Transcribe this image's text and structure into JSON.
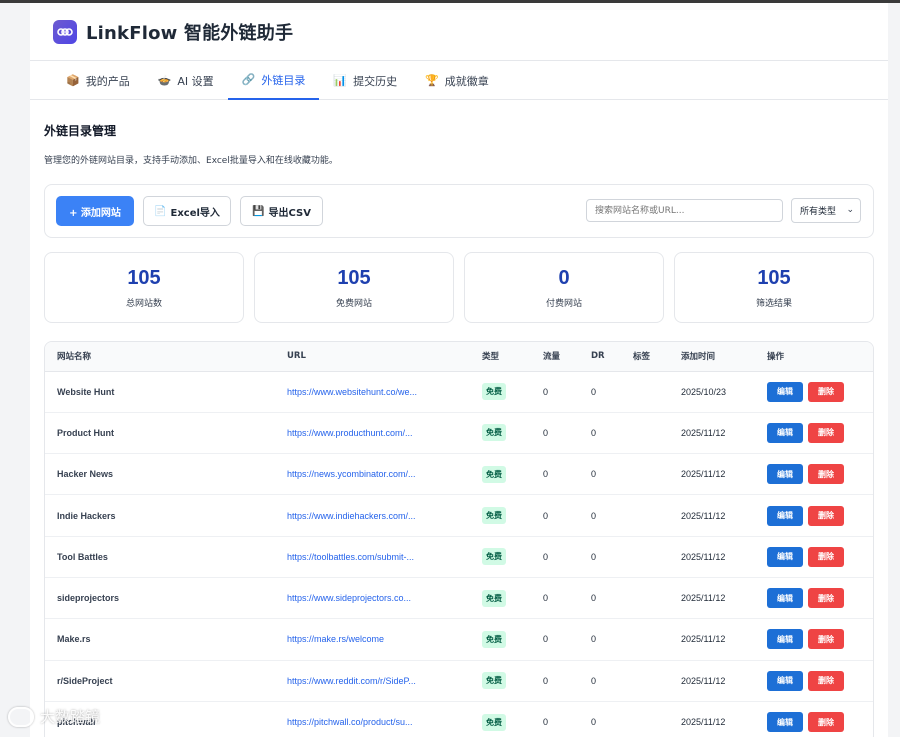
{
  "app": {
    "title": "LinkFlow 智能外链助手"
  },
  "tabs": [
    {
      "icon": "📦",
      "label": "我的产品"
    },
    {
      "icon": "🍲",
      "label": "AI 设置"
    },
    {
      "icon": "🔗",
      "label": "外链目录"
    },
    {
      "icon": "📊",
      "label": "提交历史"
    },
    {
      "icon": "🏆",
      "label": "成就徽章"
    }
  ],
  "active_tab": "外链目录",
  "section": {
    "title": "外链目录管理",
    "description": "管理您的外链网站目录，支持手动添加、Excel批量导入和在线收藏功能。"
  },
  "toolbar": {
    "add_label": "+ 添加网站",
    "import_icon": "📄",
    "import_label": "Excel导入",
    "export_icon": "💾",
    "export_label": "导出CSV",
    "search_placeholder": "搜索网站名称或URL...",
    "type_select_value": "所有类型"
  },
  "stats": [
    {
      "value": "105",
      "label": "总网站数"
    },
    {
      "value": "105",
      "label": "免费网站"
    },
    {
      "value": "0",
      "label": "付费网站"
    },
    {
      "value": "105",
      "label": "筛选结果"
    }
  ],
  "table": {
    "headers": [
      "网站名称",
      "URL",
      "类型",
      "流量",
      "DR",
      "标签",
      "添加时间",
      "操作"
    ],
    "edit_label": "编辑",
    "delete_label": "删除",
    "rows": [
      {
        "name": "Website Hunt",
        "url": "https://www.websitehunt.co/we...",
        "type": "免费",
        "traffic": "0",
        "dr": "0",
        "tags": "",
        "date": "2025/10/23"
      },
      {
        "name": "Product Hunt",
        "url": "https://www.producthunt.com/...",
        "type": "免费",
        "traffic": "0",
        "dr": "0",
        "tags": "",
        "date": "2025/11/12"
      },
      {
        "name": "Hacker News",
        "url": "https://news.ycombinator.com/...",
        "type": "免费",
        "traffic": "0",
        "dr": "0",
        "tags": "",
        "date": "2025/11/12"
      },
      {
        "name": "Indie Hackers",
        "url": "https://www.indiehackers.com/...",
        "type": "免费",
        "traffic": "0",
        "dr": "0",
        "tags": "",
        "date": "2025/11/12"
      },
      {
        "name": "Tool Battles",
        "url": "https://toolbattles.com/submit-...",
        "type": "免费",
        "traffic": "0",
        "dr": "0",
        "tags": "",
        "date": "2025/11/12"
      },
      {
        "name": "sideprojectors",
        "url": "https://www.sideprojectors.co...",
        "type": "免费",
        "traffic": "0",
        "dr": "0",
        "tags": "",
        "date": "2025/11/12"
      },
      {
        "name": "Make.rs",
        "url": "https://make.rs/welcome",
        "type": "免费",
        "traffic": "0",
        "dr": "0",
        "tags": "",
        "date": "2025/11/12"
      },
      {
        "name": "r/SideProject",
        "url": "https://www.reddit.com/r/SideP...",
        "type": "免费",
        "traffic": "0",
        "dr": "0",
        "tags": "",
        "date": "2025/11/12"
      },
      {
        "name": "pitchwall",
        "url": "https://pitchwall.co/product/su...",
        "type": "免费",
        "traffic": "0",
        "dr": "0",
        "tags": "",
        "date": "2025/11/12"
      }
    ]
  },
  "watermark": {
    "text": "大数踏镜"
  },
  "colors": {
    "primary": "#3b82f6",
    "danger": "#ef4444",
    "badge_bg": "#d1fae5",
    "stat_number": "#1e40af"
  }
}
